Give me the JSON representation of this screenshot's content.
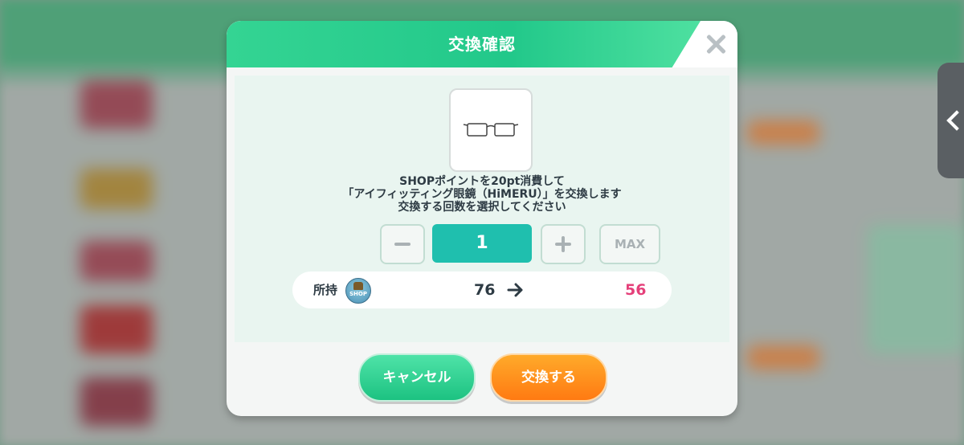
{
  "dialog": {
    "title": "交換確認",
    "close_icon": "close-icon"
  },
  "item": {
    "icon": "glasses-icon"
  },
  "message": {
    "line1": "SHOPポイントを20pt消費して",
    "line2": "「アイフィッティング眼鏡（HiMERU）」を交換します",
    "line3": "交換する回数を選択してください"
  },
  "quantity": {
    "value": "1",
    "max_label": "MAX"
  },
  "owned": {
    "label": "所持",
    "icon_text": "SHOP",
    "before": "76",
    "after": "56"
  },
  "buttons": {
    "cancel": "キャンセル",
    "confirm": "交換する"
  },
  "colors": {
    "header": "#22c88a",
    "quantity_field": "#1fbfae",
    "after_value": "#e5407a",
    "confirm": "#ff7a12",
    "cancel": "#1cc281"
  }
}
